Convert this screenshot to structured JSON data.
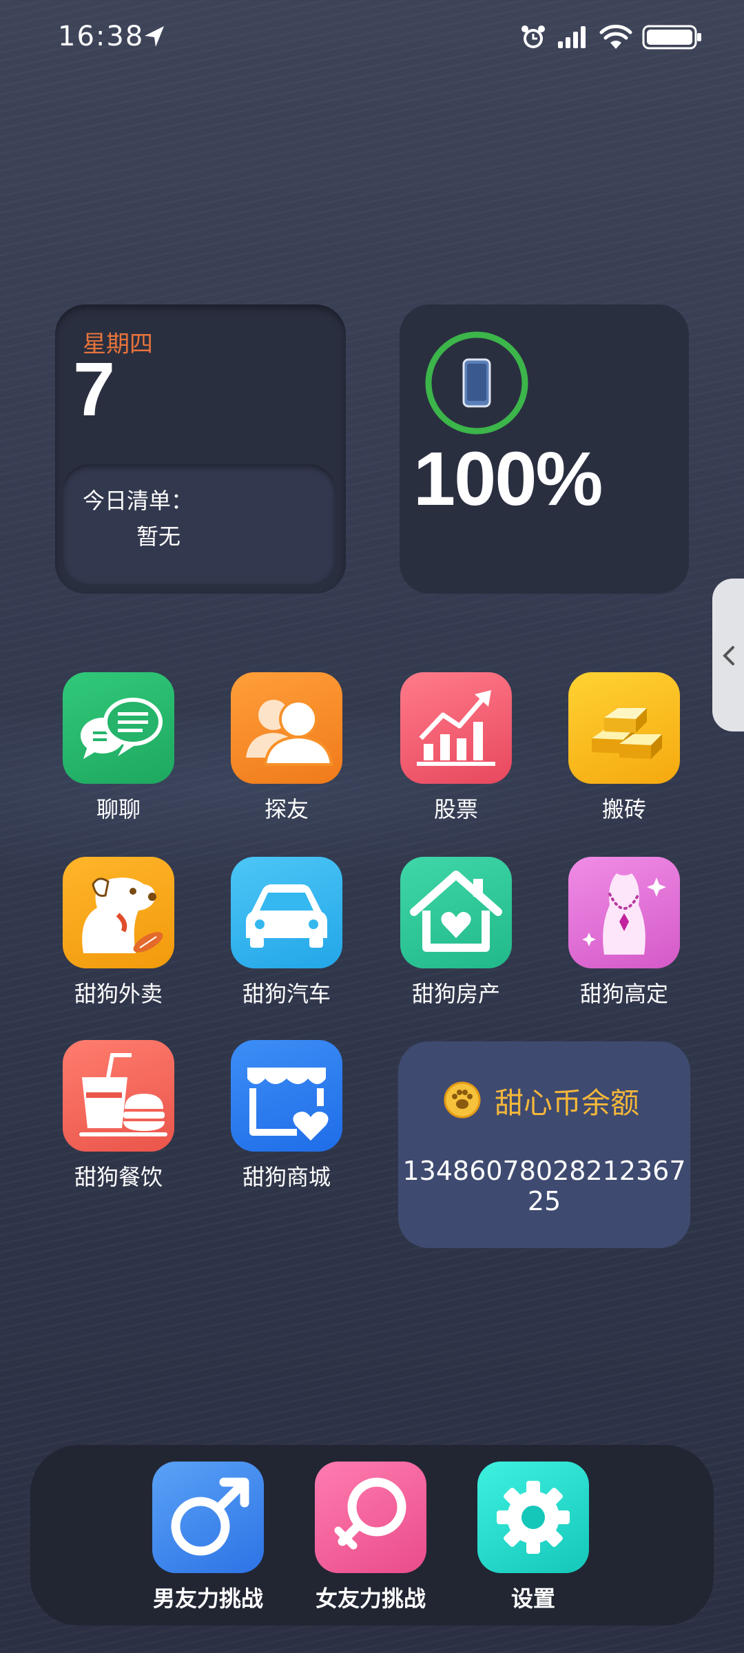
{
  "status_bar": {
    "time": "16:38",
    "icons": [
      "location-arrow-icon",
      "alarm-icon",
      "signal-icon",
      "wifi-icon",
      "battery-icon"
    ]
  },
  "date_widget": {
    "weekday": "星期四",
    "day": "7",
    "todo_title": "今日清单：",
    "todo_value": "暂无"
  },
  "battery_widget": {
    "percent_text": "100%",
    "percent_value": 100,
    "ring_color": "#3cb54a"
  },
  "apps": [
    {
      "label": "聊聊",
      "icon": "chat-bubbles-icon",
      "color": "#25b46a"
    },
    {
      "label": "探友",
      "icon": "people-icon",
      "color": "#f7912a"
    },
    {
      "label": "股票",
      "icon": "stock-chart-icon",
      "color": "#f0596f"
    },
    {
      "label": "搬砖",
      "icon": "gold-bars-icon",
      "color": "#f7b71c"
    },
    {
      "label": "甜狗外卖",
      "icon": "dog-icon",
      "color": "#f5a313"
    },
    {
      "label": "甜狗汽车",
      "icon": "car-icon",
      "color": "#35b8f0"
    },
    {
      "label": "甜狗房产",
      "icon": "house-heart-icon",
      "color": "#2ec99a"
    },
    {
      "label": "甜狗高定",
      "icon": "necklace-icon",
      "color": "#e472d8"
    },
    {
      "label": "甜狗餐饮",
      "icon": "food-drink-icon",
      "color": "#f26a5e"
    },
    {
      "label": "甜狗商城",
      "icon": "store-heart-icon",
      "color": "#2d7df2"
    }
  ],
  "coin_widget": {
    "title": "甜心币余额",
    "value": "13486078028212367​25",
    "icon": "paw-coin-icon"
  },
  "dock": [
    {
      "label": "男友力挑战",
      "icon": "male-symbol-icon",
      "color": "#3a86ee"
    },
    {
      "label": "女友力挑战",
      "icon": "female-symbol-icon",
      "color": "#f2629a"
    },
    {
      "label": "设置",
      "icon": "gear-icon",
      "color": "#1ed8c6"
    }
  ]
}
